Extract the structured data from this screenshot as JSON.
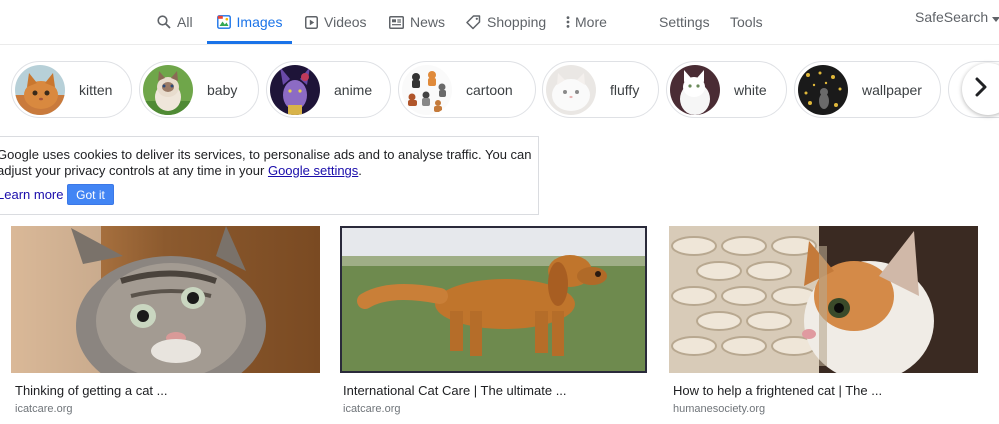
{
  "nav": {
    "tabs": [
      {
        "label": "All",
        "icon": "search-icon"
      },
      {
        "label": "Images",
        "icon": "image-icon",
        "active": true
      },
      {
        "label": "Videos",
        "icon": "play-icon"
      },
      {
        "label": "News",
        "icon": "news-icon"
      },
      {
        "label": "Shopping",
        "icon": "tag-icon"
      },
      {
        "label": "More",
        "icon": "more-vert-icon"
      }
    ],
    "settings": "Settings",
    "tools": "Tools",
    "safesearch": "SafeSearch",
    "accent_color": "#1a73e8"
  },
  "chips": [
    {
      "label": "kitten"
    },
    {
      "label": "baby"
    },
    {
      "label": "anime"
    },
    {
      "label": "cartoon"
    },
    {
      "label": "fluffy"
    },
    {
      "label": "white"
    },
    {
      "label": "wallpaper"
    }
  ],
  "cookie": {
    "line1": "Google uses cookies to deliver its services, to personalise ads and to analyse traffic. You can",
    "line2_prefix": "adjust your privacy controls at any time in your ",
    "line2_link": "Google settings",
    "line2_suffix": ".",
    "learn_more": "Learn more",
    "got_it": "Got it"
  },
  "results": [
    {
      "title": "Thinking of getting a cat ...",
      "site": "icatcare.org"
    },
    {
      "title": "International Cat Care | The ultimate ...",
      "site": "icatcare.org"
    },
    {
      "title": "How to help a frightened cat | The ...",
      "site": "humanesociety.org"
    }
  ]
}
